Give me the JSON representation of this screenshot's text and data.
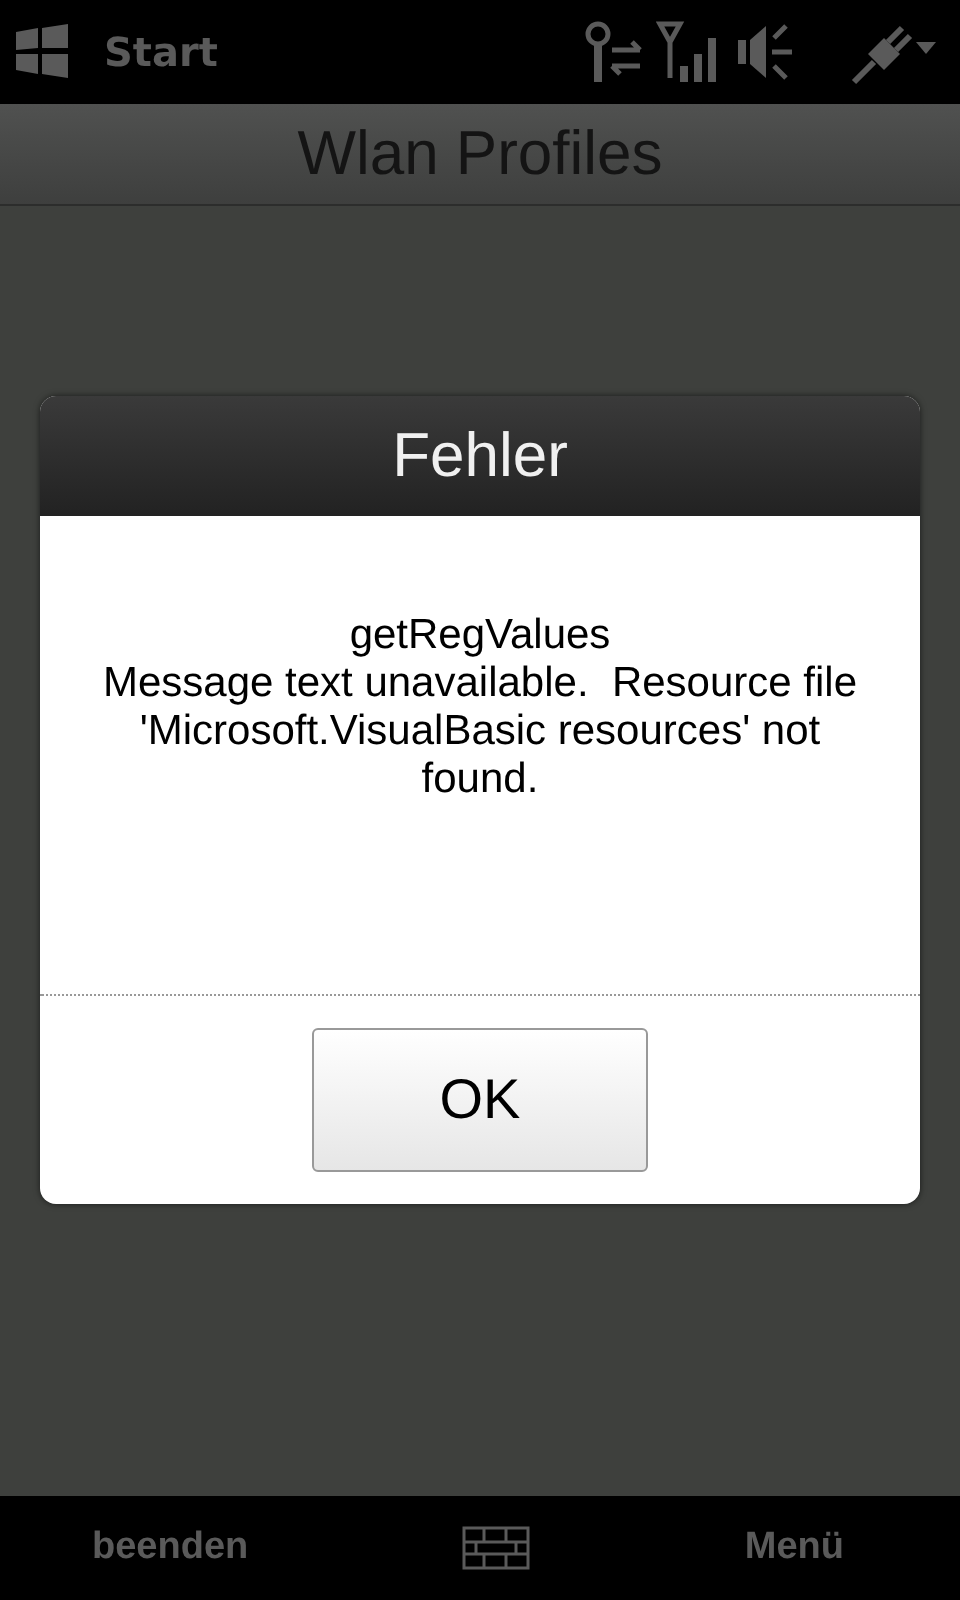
{
  "status_bar": {
    "start_label": "Start"
  },
  "title_bar": {
    "title": "Wlan Profiles"
  },
  "dialog": {
    "title": "Fehler",
    "message_title": "getRegValues",
    "message": "Message text unavailable.  Resource file 'Microsoft.VisualBasic resources' not found.",
    "button": "OK"
  },
  "soft_keys": {
    "left": "beenden",
    "right": "Menü"
  }
}
